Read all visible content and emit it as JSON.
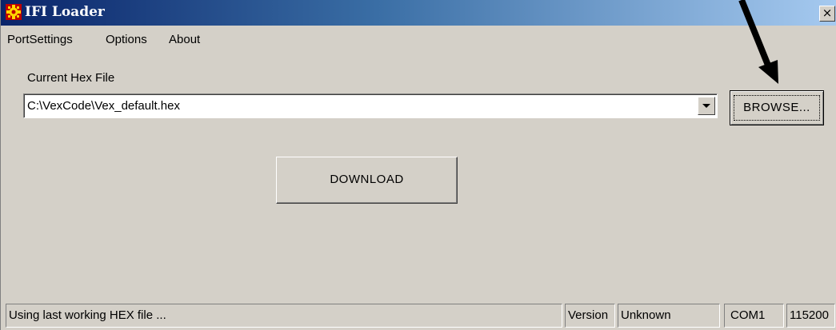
{
  "window": {
    "title": "IFI Loader",
    "close_label": "×",
    "title_gradient_start": "#0a246a",
    "title_gradient_end": "#a6caf0"
  },
  "menubar": {
    "items": [
      "PortSettings",
      "Options",
      "About"
    ]
  },
  "main": {
    "hex_file_label": "Current Hex File",
    "hex_file_value": "C:\\VexCode\\Vex_default.hex",
    "browse_label": "BROWSE...",
    "download_label": "DOWNLOAD"
  },
  "statusbar": {
    "message": "Using last working HEX file ...",
    "version_label": "Version",
    "version_value": "Unknown",
    "port": "COM1",
    "baud": "115200"
  },
  "annotation": {
    "arrow_color": "#000000",
    "target": "browse-button"
  }
}
